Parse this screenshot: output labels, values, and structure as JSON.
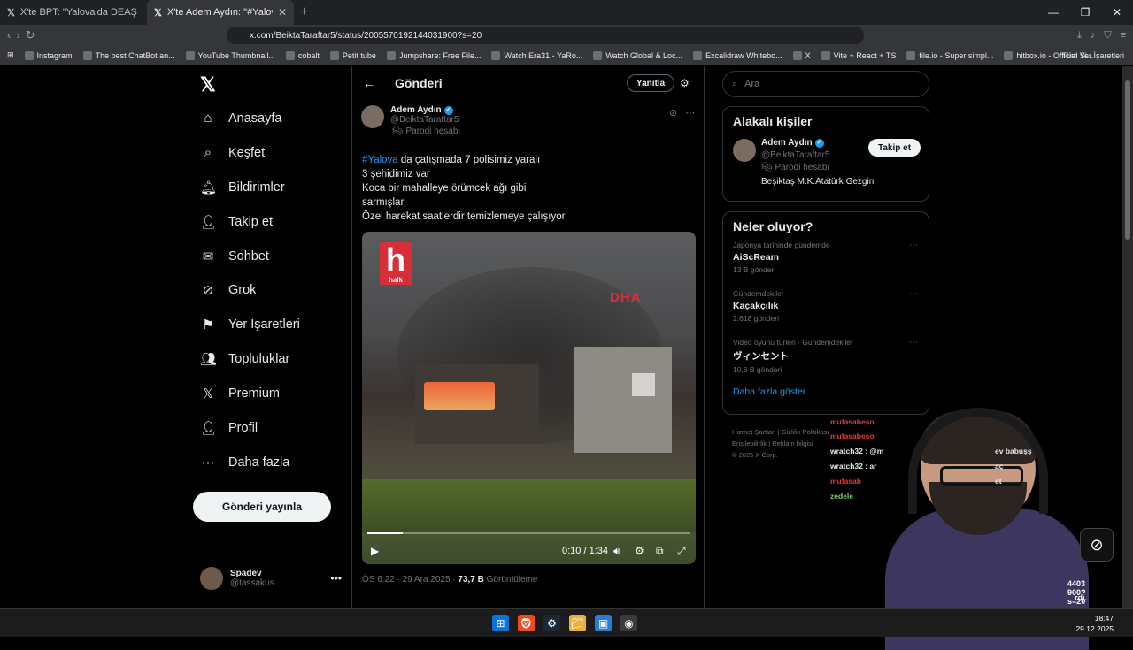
{
  "browser": {
    "tabs": [
      {
        "title": "X'te BPT: \"Yalova'da DEAŞ operasyon\"",
        "active": false
      },
      {
        "title": "X'te Adem Aydın: \"#Yalova da ça",
        "active": true
      }
    ],
    "url": "x.com/BeiktaTaraftar5/status/2005570192144031900?s=20",
    "bookmarks": [
      "Instagram",
      "The best ChatBot an...",
      "YouTube Thumbnail...",
      "cobalt",
      "Petit tube",
      "Jumpshare: Free File...",
      "Watch Era31 - YaRo...",
      "Watch Global & Loc...",
      "Excalidraw Whitebo...",
      "X",
      "Vite + React + TS",
      "file.io - Super simpl...",
      "hitbox.io - Official Si..."
    ],
    "bookmarks_all": "Tüm Yer İşaretleri"
  },
  "nav": {
    "items": [
      "Anasayfa",
      "Keşfet",
      "Bildirimler",
      "Takip et",
      "Sohbet",
      "Grok",
      "Yer İşaretleri",
      "Topluluklar",
      "Premium",
      "Profil",
      "Daha fazla"
    ],
    "post_button": "Gönderi yayınla",
    "account_name": "Spadev",
    "account_handle": "@tassakus"
  },
  "main": {
    "title": "Gönderi",
    "reply_button": "Yanıtla",
    "author_name": "Adem Aydın",
    "author_handle": "@BeiktaTaraftar5",
    "parody": "Parodi hesabı",
    "hashtag": "#Yalova",
    "text_line1_rest": " da çatışmada 7 polisimiz  yaralı",
    "text_lines": [
      "3 şehidimiz var",
      "Koca bir mahalleye örümcek ağı gibi",
      "sarmışlar",
      "Özel harekat saatlerdir temizlemeye çalışıyor"
    ],
    "video_logo_left": "h",
    "video_logo_left_sub": "halk",
    "video_logo_right": "DHA",
    "video_time": "0:10 / 1:34",
    "video_progress": 0.11,
    "meta_time": "ÖS 6:22 · 29 Ara 2025 · ",
    "meta_views": "73,7 B",
    "meta_views_label": " Görüntüleme"
  },
  "right": {
    "search_placeholder": "Ara",
    "related_title": "Alakalı kişiler",
    "related_name": "Adem Aydın",
    "related_handle": "@BeiktaTaraftar5",
    "related_parody": "Parodi hesabı",
    "related_bio": "Beşiktaş M.K.Atatürk Gezgin",
    "follow_button": "Takip et",
    "trends_title": "Neler oluyor?",
    "trends": [
      {
        "context": "Japonya tarihinde gündemde",
        "name": "AiScReam",
        "count": "13 B gönderi"
      },
      {
        "context": "Gündemdekiler",
        "name": "Kaçakçılık",
        "count": "2.618 gönderi"
      },
      {
        "context": "Video oyunu türleri · Gündemdekiler",
        "name": "ヴィンセント",
        "count": "10,6 B gönderi"
      }
    ],
    "show_more": "Daha fazla göster",
    "footer": [
      "Hizmet Şartları",
      "Gizlilik Politikası",
      "Erişilebilirlik",
      "Reklam bilgisi",
      "© 2025 X Corp."
    ]
  },
  "overlay": {
    "chat": [
      {
        "text": "mufasabeso",
        "color": "red"
      },
      {
        "text": "mufasabeso",
        "color": "red"
      },
      {
        "text": "wratch32 : @m",
        "color": "white"
      },
      {
        "text": "wratch32 : ar",
        "color": "white"
      },
      {
        "text": "mufasab",
        "color": "red"
      },
      {
        "text": "zedele",
        "color": "green"
      }
    ],
    "chat_side": [
      "ev babuşş",
      "aç",
      "et"
    ],
    "side_text": "4403 900?s=20",
    "side_text2": "rdı."
  },
  "taskbar": {
    "time": "18:47",
    "date": "29.12.2025"
  }
}
